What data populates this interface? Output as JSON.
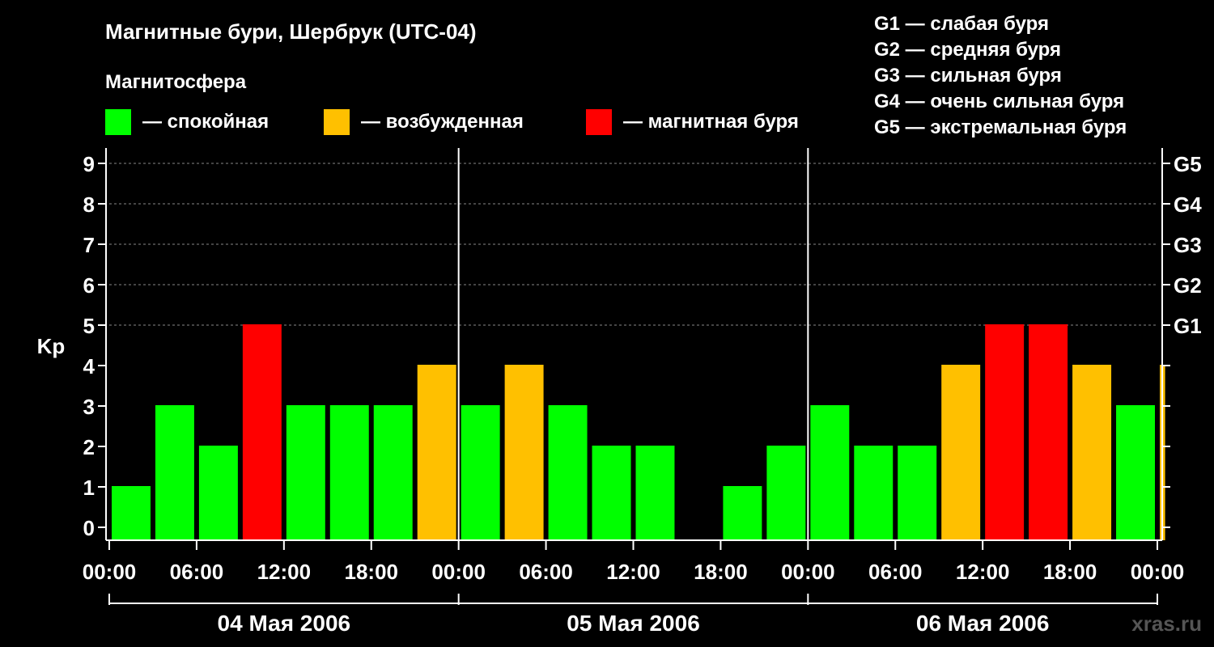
{
  "colors": {
    "background": "#000000",
    "quiet": "#00ff00",
    "disturbed": "#ffc000",
    "storm": "#ff0000",
    "axis": "#ffffff",
    "grid": "#888888"
  },
  "chart_data": {
    "type": "bar",
    "title": "Магнитные бури, Шербрук (UTC-04)",
    "ylabel": "Kp",
    "ylim": [
      0,
      9
    ],
    "yticks": [
      "0",
      "1",
      "2",
      "3",
      "4",
      "5",
      "6",
      "7",
      "8",
      "9"
    ],
    "gridlines_at": [
      5,
      6,
      7,
      8,
      9
    ],
    "legend": {
      "title": "Магнитосфера",
      "items": [
        {
          "color_key": "quiet",
          "label": "— спокойная"
        },
        {
          "color_key": "disturbed",
          "label": "— возбужденная"
        },
        {
          "color_key": "storm",
          "label": "— магнитная буря"
        }
      ]
    },
    "g_scale_legend": [
      "G1 — слабая буря",
      "G2 — средняя буря",
      "G3 — сильная буря",
      "G4 — очень сильная буря",
      "G5 — экстремальная буря"
    ],
    "g_axis": [
      {
        "label": "G1",
        "kp": 5
      },
      {
        "label": "G2",
        "kp": 6
      },
      {
        "label": "G3",
        "kp": 7
      },
      {
        "label": "G4",
        "kp": 8
      },
      {
        "label": "G5",
        "kp": 9
      }
    ],
    "x_tick_labels": [
      "00:00",
      "06:00",
      "12:00",
      "18:00",
      "00:00",
      "06:00",
      "12:00",
      "18:00",
      "00:00",
      "06:00",
      "12:00",
      "18:00",
      "00:00"
    ],
    "days": [
      "04 Мая 2006",
      "05 Мая 2006",
      "06 Мая 2006"
    ],
    "x_hours_range": [
      0,
      72
    ],
    "bars": [
      {
        "start_hour": 0,
        "end_hour": 3,
        "kp": 1,
        "level": "quiet"
      },
      {
        "start_hour": 3,
        "end_hour": 6,
        "kp": 3,
        "level": "quiet"
      },
      {
        "start_hour": 6,
        "end_hour": 9,
        "kp": 2,
        "level": "quiet"
      },
      {
        "start_hour": 9,
        "end_hour": 12,
        "kp": 5,
        "level": "storm"
      },
      {
        "start_hour": 12,
        "end_hour": 15,
        "kp": 3,
        "level": "quiet"
      },
      {
        "start_hour": 15,
        "end_hour": 18,
        "kp": 3,
        "level": "quiet"
      },
      {
        "start_hour": 18,
        "end_hour": 21,
        "kp": 3,
        "level": "quiet"
      },
      {
        "start_hour": 21,
        "end_hour": 24,
        "kp": 4,
        "level": "disturbed"
      },
      {
        "start_hour": 24,
        "end_hour": 27,
        "kp": 3,
        "level": "quiet"
      },
      {
        "start_hour": 27,
        "end_hour": 30,
        "kp": 4,
        "level": "disturbed"
      },
      {
        "start_hour": 30,
        "end_hour": 33,
        "kp": 3,
        "level": "quiet"
      },
      {
        "start_hour": 33,
        "end_hour": 36,
        "kp": 2,
        "level": "quiet"
      },
      {
        "start_hour": 36,
        "end_hour": 39,
        "kp": 2,
        "level": "quiet"
      },
      {
        "start_hour": 39,
        "end_hour": 42,
        "kp": 0,
        "level": "quiet"
      },
      {
        "start_hour": 42,
        "end_hour": 45,
        "kp": 1,
        "level": "quiet"
      },
      {
        "start_hour": 45,
        "end_hour": 48,
        "kp": 2,
        "level": "quiet"
      },
      {
        "start_hour": 48,
        "end_hour": 51,
        "kp": 3,
        "level": "quiet"
      },
      {
        "start_hour": 51,
        "end_hour": 54,
        "kp": 2,
        "level": "quiet"
      },
      {
        "start_hour": 54,
        "end_hour": 57,
        "kp": 2,
        "level": "quiet"
      },
      {
        "start_hour": 57,
        "end_hour": 60,
        "kp": 4,
        "level": "disturbed"
      },
      {
        "start_hour": 60,
        "end_hour": 63,
        "kp": 5,
        "level": "storm"
      },
      {
        "start_hour": 63,
        "end_hour": 66,
        "kp": 5,
        "level": "storm"
      },
      {
        "start_hour": 66,
        "end_hour": 69,
        "kp": 4,
        "level": "disturbed"
      },
      {
        "start_hour": 69,
        "end_hour": 72,
        "kp": 3,
        "level": "quiet"
      },
      {
        "start_hour": 72,
        "end_hour": 72.7,
        "kp": 4,
        "level": "disturbed"
      }
    ],
    "watermark": "xras.ru"
  }
}
